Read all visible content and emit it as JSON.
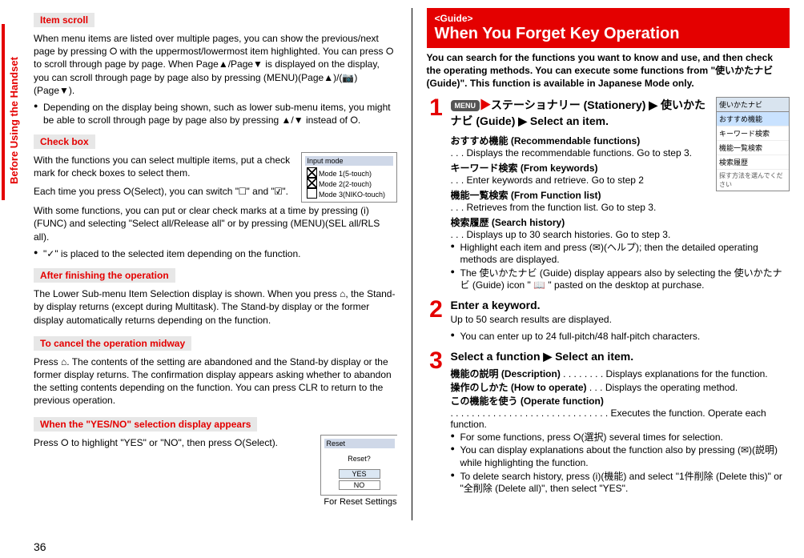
{
  "page_number": "36",
  "side_tab": "Before Using the Handset",
  "left": {
    "h_item_scroll": "Item scroll",
    "item_scroll_p": "When menu items are listed over multiple pages, you can show the previous/next page by pressing ⭘ with the uppermost/lowermost item highlighted. You can press ⭘ to scroll through page by page. When Page▲/Page▼ is displayed on the display, you can scroll through page by page also by pressing (MENU)(Page▲)/(📷)(Page▼).",
    "item_scroll_b1": "Depending on the display being shown, such as lower sub-menu items, you might be able to scroll through page by page also by pressing ▲/▼ instead of ⭘.",
    "h_check": "Check box",
    "check_p1a": "With the functions you can select multiple items, put a check mark for check boxes to select them.",
    "check_p1b": "Each time you press ⭘(Select), you can switch \"☐\" and \"☑\".",
    "check_p2": "With some functions, you can put or clear check marks at a time by pressing (i)(FUNC) and selecting \"Select all/Release all\" or by pressing (MENU)(SEL all/RLS all).",
    "check_b1": "\"✓\" is placed to the selected item depending on the function.",
    "screenshot_check": {
      "title": "Input mode",
      "rows": [
        "Mode 1(5-touch)",
        "Mode 2(2-touch)",
        "Mode 3(NIKO-touch)"
      ]
    },
    "h_after": "After finishing the operation",
    "after_p": "The Lower Sub-menu Item Selection display is shown. When you press ⌂, the Stand-by display returns (except during Multitask). The Stand-by display or the former display automatically returns depending on the function.",
    "h_cancel": "To cancel the operation midway",
    "cancel_p": "Press ⌂. The contents of the setting are abandoned and the Stand-by display or the former display returns. The confirmation display appears asking whether to abandon the setting contents depending on the function. You can press CLR to return to the previous operation.",
    "h_yesno": "When the \"YES/NO\" selection display appears",
    "yesno_p": "Press ⭘ to highlight \"YES\" or \"NO\", then press ⭘(Select).",
    "screenshot_reset": {
      "title": "Reset",
      "body": "Reset?",
      "yes": "YES",
      "no": "NO",
      "caption": "For Reset Settings"
    }
  },
  "right": {
    "guide_tag": "<Guide>",
    "guide_title": "When You Forget Key Operation",
    "lead": "You can search for the functions you want to know and use, and then check the operating methods. You can execute some functions from \"使いかたナビ (Guide)\". This function is available in Japanese Mode only.",
    "step1_line": "ステーショナリー (Stationery) ▶ 使いかたナビ (Guide) ▶ Select an item.",
    "step1_menu": "MENU",
    "phone": {
      "hdr": "使いかたナビ",
      "opts": [
        "おすすめ機能",
        "キーワード検索",
        "機能一覧検索",
        "検索履歴"
      ],
      "foot": "探す方法を選んでください"
    },
    "s1_items": [
      {
        "t": "おすすめ機能 (Recommendable functions)",
        "d": ". . .  Displays the recommendable functions. Go to step 3."
      },
      {
        "t": "キーワード検索 (From keywords)",
        "d": ". . .  Enter keywords and retrieve. Go to step 2"
      },
      {
        "t": "機能一覧検索 (From Function list)",
        "d": ". . .  Retrieves from the function list. Go to step 3."
      },
      {
        "t": "検索履歴 (Search history)",
        "d": ". . .  Displays up to 30 search histories. Go to step 3."
      }
    ],
    "s1_b1": "Highlight each item and press (✉)(ヘルプ); then the detailed operating methods are displayed.",
    "s1_b2": "The 使いかたナビ (Guide) display appears also by selecting the 使いかたナビ (Guide) icon \" 📖 \" pasted on the desktop at purchase.",
    "step2_title": "Enter a keyword.",
    "s2_p": "Up to 50 search results are displayed.",
    "s2_b1": "You can enter up to 24 full-pitch/48 half-pitch characters.",
    "step3_title": "Select a function ▶ Select an item.",
    "s3_items": [
      {
        "t": "機能の説明 (Description)",
        "d": " . . . . . . . . Displays explanations for the function."
      },
      {
        "t": "操作のしかた (How to operate)",
        "d": " . . . Displays the operating method."
      },
      {
        "t": "この機能を使う (Operate function)",
        "d": ""
      }
    ],
    "s3_exec": " . . . . . . . . . . . . . . . . . . . . . . . . . . . . . . Executes the function. Operate each function.",
    "s3_b1": "For some functions, press ⭘(選択) several times for selection.",
    "s3_b2": "You can display explanations about the function also by pressing (✉)(説明) while highlighting the function.",
    "s3_b3": "To delete search history, press (i)(機能) and select \"1件削除 (Delete this)\" or \"全削除 (Delete all)\", then select \"YES\"."
  }
}
